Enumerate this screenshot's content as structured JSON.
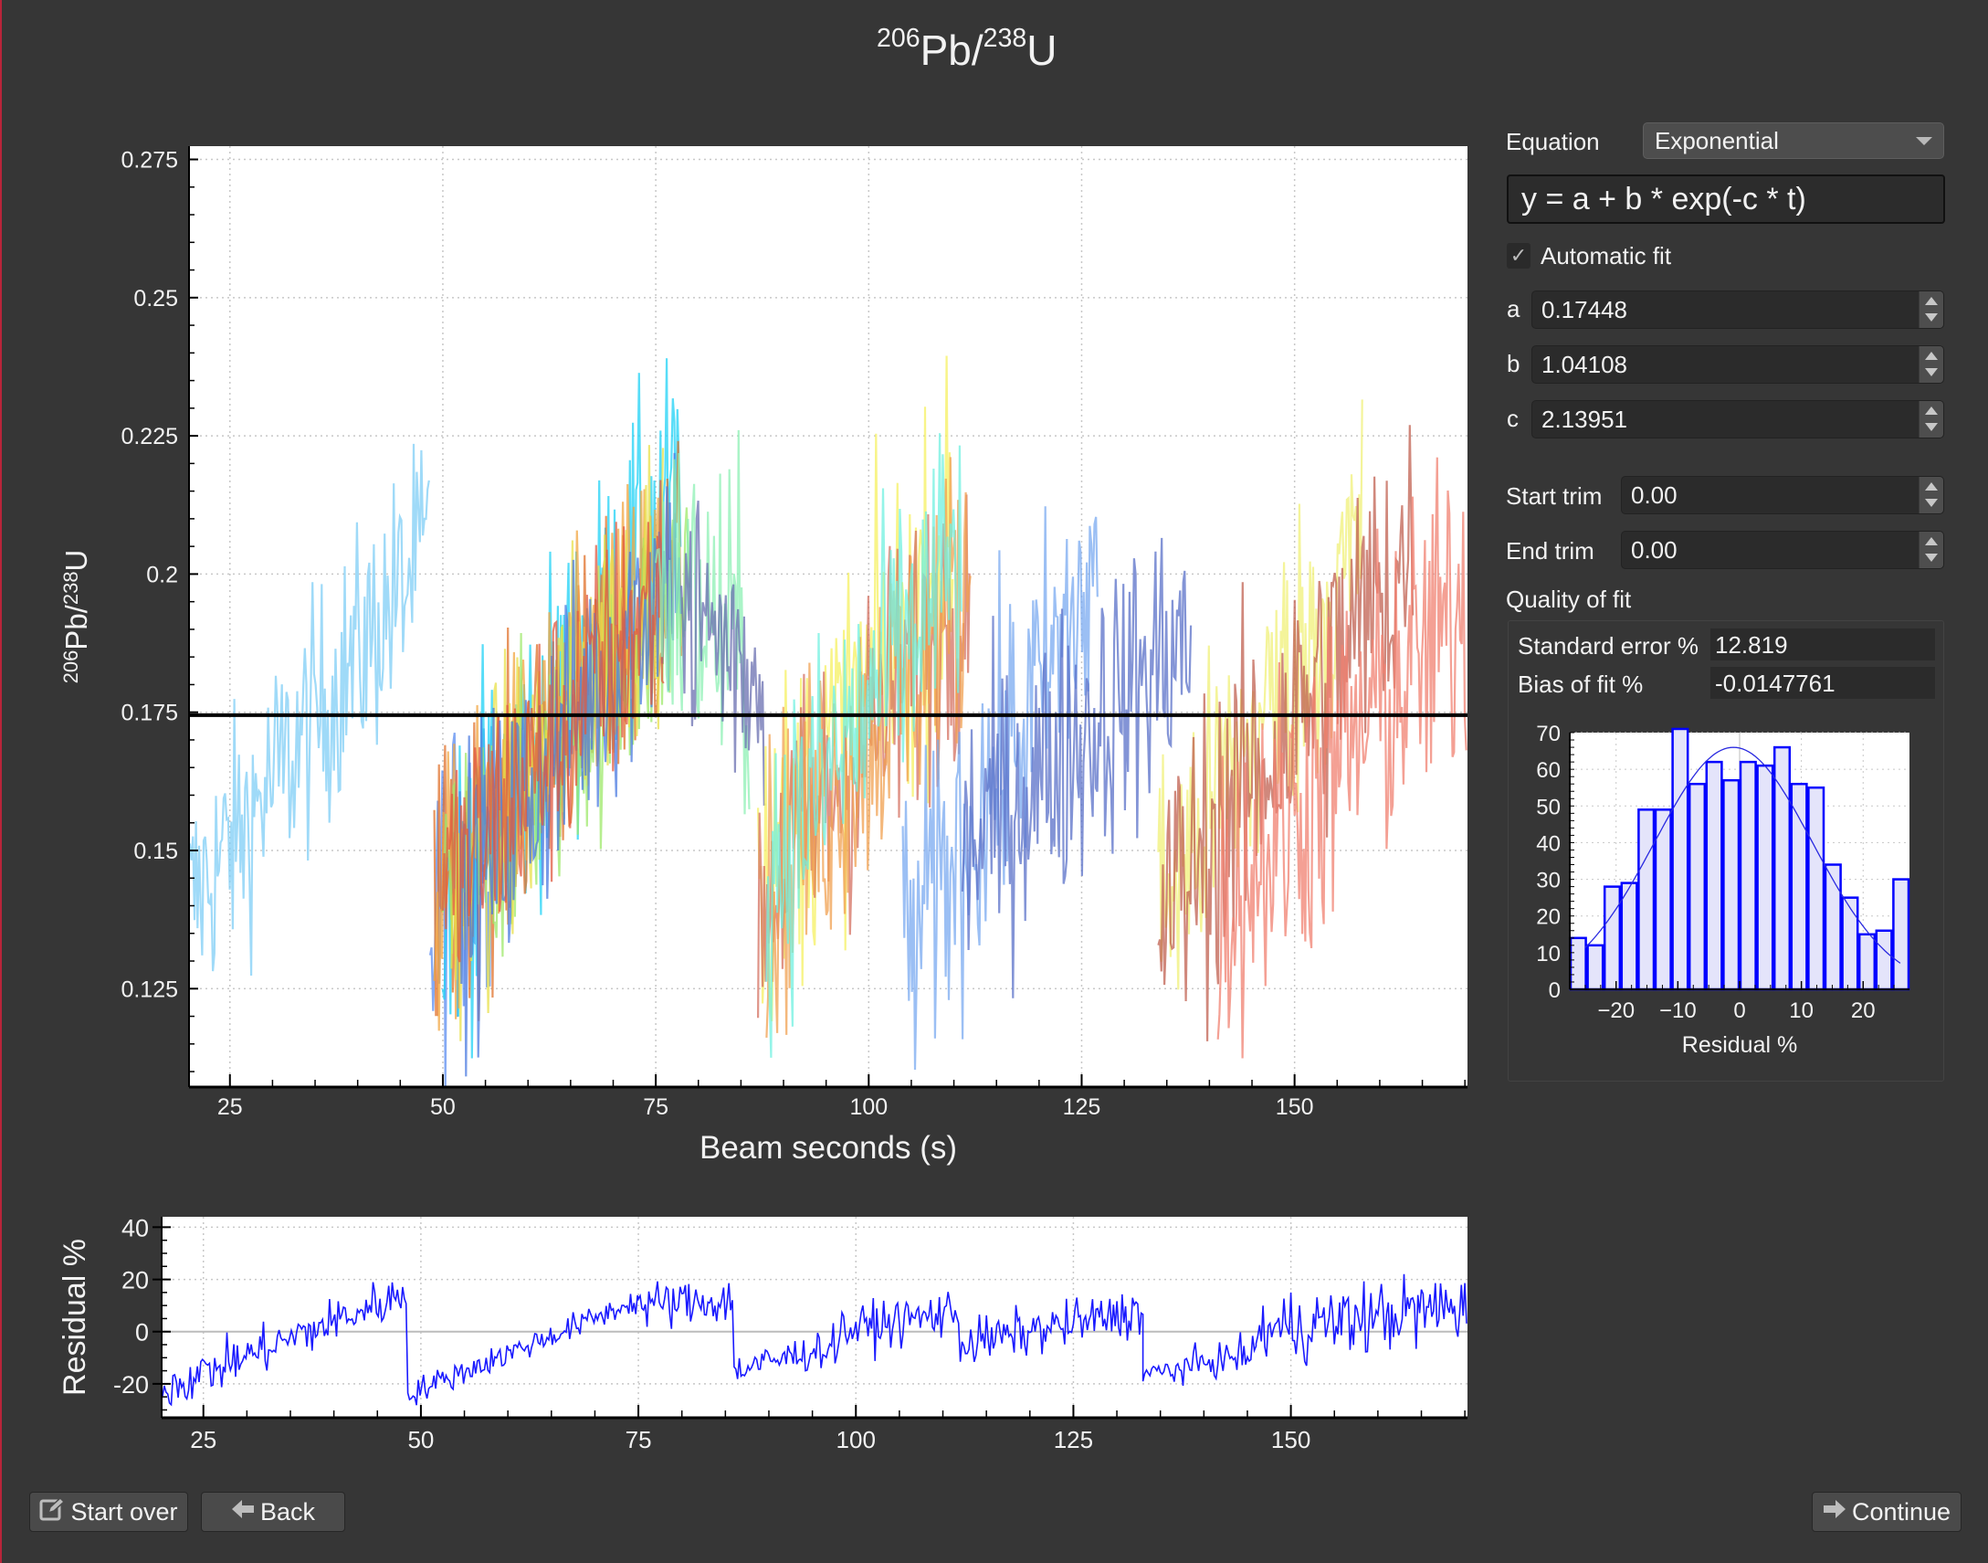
{
  "window": {
    "title": {
      "iso1": "206",
      "el1": "Pb/",
      "iso2": "238",
      "el2": "U"
    }
  },
  "controls": {
    "equation_label": "Equation",
    "equation_selected": "Exponential",
    "equation_formula": "y = a + b * exp(-c * t)",
    "automatic_fit_label": "Automatic fit",
    "automatic_fit_checked": true,
    "check_glyph": "✓",
    "params": [
      {
        "name": "a",
        "value": "0.17448"
      },
      {
        "name": "b",
        "value": "1.04108"
      },
      {
        "name": "c",
        "value": "2.13951"
      }
    ],
    "start_trim_label": "Start trim",
    "start_trim_value": "0.00",
    "end_trim_label": "End trim",
    "end_trim_value": "0.00",
    "quality_label": "Quality of fit",
    "std_error_label": "Standard error %",
    "std_error_value": "12.819",
    "bias_label": "Bias of fit %",
    "bias_value": "-0.0147761"
  },
  "buttons": {
    "start_over": "Start over",
    "back": "Back",
    "continue": "Continue",
    "start_over_icon": "edit-icon",
    "back_icon": "arrow-left-icon",
    "continue_icon": "arrow-right-icon"
  },
  "chart_data": [
    {
      "type": "line",
      "name": "ratio-vs-time",
      "title": "206Pb/238U",
      "xlabel": "Beam seconds (s)",
      "ylabel": {
        "iso1": "206",
        "el1": "Pb/",
        "iso2": "238",
        "el2": "U"
      },
      "xlim": [
        20.2,
        170.3
      ],
      "ylim": [
        0.1072,
        0.2774
      ],
      "xticks": [
        25,
        50,
        75,
        100,
        125,
        150
      ],
      "yticks": [
        0.125,
        0.15,
        0.175,
        0.2,
        0.225,
        0.25,
        0.275
      ],
      "ytick_labels": [
        "0.125",
        "0.15",
        "0.175",
        "0.2",
        "0.225",
        "0.25",
        "0.275"
      ],
      "grid": true,
      "fit_line": {
        "value": 0.17448,
        "color": "#000000"
      },
      "series_note": "many overlapping noisy traces (one per sample); each described by time window, start/end ratio and noise amplitude",
      "series": [
        {
          "color": "#7fcdf5",
          "t0": 20.3,
          "t1": 48.5,
          "y0": 0.14,
          "y1": 0.205,
          "noise": 0.022
        },
        {
          "color": "#5b8cf0",
          "t0": 48.5,
          "t1": 56,
          "y0": 0.135,
          "y1": 0.16,
          "noise": 0.03
        },
        {
          "color": "#1fd1f5",
          "t0": 50,
          "t1": 78,
          "y0": 0.14,
          "y1": 0.215,
          "noise": 0.028
        },
        {
          "color": "#e0702a",
          "t0": 49,
          "t1": 78,
          "y0": 0.14,
          "y1": 0.2,
          "noise": 0.025
        },
        {
          "color": "#f2a640",
          "t0": 49,
          "t1": 77,
          "y0": 0.138,
          "y1": 0.205,
          "noise": 0.024
        },
        {
          "color": "#9ee86a",
          "t0": 50,
          "t1": 79,
          "y0": 0.14,
          "y1": 0.2,
          "noise": 0.024
        },
        {
          "color": "#e8e04a",
          "t0": 51,
          "t1": 76,
          "y0": 0.14,
          "y1": 0.205,
          "noise": 0.026
        },
        {
          "color": "#4a7ae0",
          "t0": 52,
          "t1": 78,
          "y0": 0.14,
          "y1": 0.205,
          "noise": 0.026
        },
        {
          "color": "#e05a40",
          "t0": 50,
          "t1": 76,
          "y0": 0.142,
          "y1": 0.198,
          "noise": 0.025
        },
        {
          "color": "#8ef0b4",
          "t0": 75,
          "t1": 86,
          "y0": 0.2,
          "y1": 0.185,
          "noise": 0.03
        },
        {
          "color": "#6a6fb0",
          "t0": 78,
          "t1": 88,
          "y0": 0.195,
          "y1": 0.18,
          "noise": 0.025
        },
        {
          "color": "#f5f060",
          "t0": 87,
          "t1": 110,
          "y0": 0.145,
          "y1": 0.205,
          "noise": 0.03
        },
        {
          "color": "#d47060",
          "t0": 87,
          "t1": 112,
          "y0": 0.14,
          "y1": 0.2,
          "noise": 0.028
        },
        {
          "color": "#f0a050",
          "t0": 88,
          "t1": 112,
          "y0": 0.142,
          "y1": 0.2,
          "noise": 0.028
        },
        {
          "color": "#70f0e0",
          "t0": 88,
          "t1": 111,
          "y0": 0.145,
          "y1": 0.205,
          "noise": 0.028
        },
        {
          "color": "#7aaaf0",
          "t0": 104,
          "t1": 127,
          "y0": 0.13,
          "y1": 0.2,
          "noise": 0.028
        },
        {
          "color": "#5a70c8",
          "t0": 111,
          "t1": 138,
          "y0": 0.15,
          "y1": 0.19,
          "noise": 0.026
        },
        {
          "color": "#f0f078",
          "t0": 134,
          "t1": 158,
          "y0": 0.14,
          "y1": 0.205,
          "noise": 0.028
        },
        {
          "color": "#c06050",
          "t0": 134,
          "t1": 164,
          "y0": 0.138,
          "y1": 0.205,
          "noise": 0.028
        },
        {
          "color": "#f08070",
          "t0": 141,
          "t1": 170.3,
          "y0": 0.14,
          "y1": 0.195,
          "noise": 0.03
        }
      ]
    },
    {
      "type": "line",
      "name": "residual-vs-time",
      "title": "",
      "xlabel": "",
      "ylabel": "Residual %",
      "xlim": [
        20.2,
        170.3
      ],
      "ylim": [
        -33,
        44
      ],
      "xticks": [
        25,
        50,
        75,
        100,
        125,
        150
      ],
      "yticks": [
        -20,
        0,
        20,
        40
      ],
      "grid": true,
      "color": "#1a1aff",
      "series_note": "single residual trace described by piecewise trend segments with noise amplitude",
      "segments": [
        {
          "t0": 20.3,
          "t1": 48.5,
          "r0": -22,
          "r1": 15,
          "noise": 9
        },
        {
          "t0": 48.5,
          "t1": 75,
          "r0": -24,
          "r1": 12,
          "noise": 5
        },
        {
          "t0": 75,
          "t1": 86,
          "r0": 10,
          "r1": 12,
          "noise": 9
        },
        {
          "t0": 86,
          "t1": 98,
          "r0": -15,
          "r1": -5,
          "noise": 7
        },
        {
          "t0": 98,
          "t1": 112,
          "r0": 0,
          "r1": 8,
          "noise": 9
        },
        {
          "t0": 112,
          "t1": 133,
          "r0": -5,
          "r1": 8,
          "noise": 9
        },
        {
          "t0": 133,
          "t1": 146,
          "r0": -17,
          "r1": -8,
          "noise": 6
        },
        {
          "t0": 146,
          "t1": 170.3,
          "r0": 0,
          "r1": 10,
          "noise": 14
        }
      ]
    },
    {
      "type": "bar",
      "name": "residual-histogram",
      "title": "",
      "xlabel": "Residual %",
      "ylabel": "",
      "xlim": [
        -27.5,
        27.5
      ],
      "ylim": [
        0,
        70
      ],
      "xticks": [
        -20,
        -10,
        0,
        10,
        20
      ],
      "yticks": [
        0,
        10,
        20,
        30,
        40,
        50,
        60,
        70
      ],
      "grid": true,
      "bin_edges": [
        -27.5,
        -24.75,
        -22,
        -19.25,
        -16.5,
        -13.75,
        -11,
        -8.25,
        -5.5,
        -2.75,
        0,
        2.75,
        5.5,
        8.25,
        11,
        13.75,
        16.5,
        19.25,
        22,
        24.75,
        27.5
      ],
      "values": [
        14,
        12,
        28,
        29,
        49,
        49,
        71,
        56,
        62,
        57,
        62,
        61,
        66,
        56,
        55,
        34,
        25,
        15,
        16,
        30
      ],
      "bar_fill": "#e4e4fa",
      "bar_edge": "#0000ff",
      "normal_curve": {
        "mean": -1,
        "sd": 12.8,
        "peak": 66
      }
    }
  ]
}
